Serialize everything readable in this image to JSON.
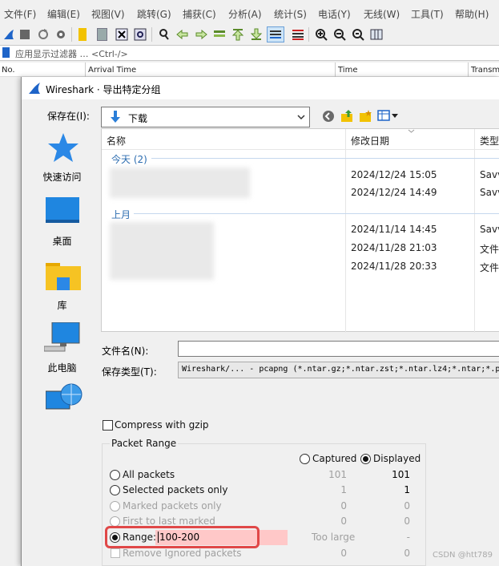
{
  "menu": [
    "文件(F)",
    "编辑(E)",
    "视图(V)",
    "跳转(G)",
    "捕获(C)",
    "分析(A)",
    "统计(S)",
    "电话(Y)",
    "无线(W)",
    "工具(T)",
    "帮助(H)"
  ],
  "filter_bar": {
    "placeholder": "应用显示过滤器 … <Ctrl-/>"
  },
  "packet_columns": [
    "No.",
    "Arrival Time",
    "Time",
    "Transm"
  ],
  "dialog": {
    "title": "Wireshark · 导出特定分组",
    "save_in_label": "保存在(I):",
    "save_in_value": "下载",
    "places": [
      "快速访问",
      "桌面",
      "库",
      "此电脑"
    ],
    "list_headers": [
      "名称",
      "修改日期",
      "类型"
    ],
    "groups": [
      {
        "label": "今天 (2)",
        "rows": [
          {
            "date": "2024/12/24 15:05",
            "type": "Savv"
          },
          {
            "date": "2024/12/24 14:49",
            "type": "Savv"
          }
        ]
      },
      {
        "label": "上月",
        "rows": [
          {
            "date": "2024/11/14 14:45",
            "type": "Savv"
          },
          {
            "date": "2024/11/28 21:03",
            "type": "文件"
          },
          {
            "date": "2024/11/28 20:33",
            "type": "文件"
          }
        ]
      }
    ],
    "filename_label": "文件名(N):",
    "filename_value": "",
    "filetype_label": "保存类型(T):",
    "filetype_value": "Wireshark/... - pcapng (*.ntar.gz;*.ntar.zst;*.ntar.lz4;*.ntar;*.pc",
    "compress_label": "Compress with gzip",
    "packet_range": {
      "title": "Packet Range",
      "captured_label": "Captured",
      "displayed_label": "Displayed",
      "rows": [
        {
          "label": "All packets",
          "captured": "101",
          "displayed": "101"
        },
        {
          "label": "Selected packets only",
          "captured": "1",
          "displayed": "1"
        },
        {
          "label": "Marked packets only",
          "captured": "0",
          "displayed": "0"
        },
        {
          "label": "First to last marked",
          "captured": "0",
          "displayed": "0"
        },
        {
          "label": "Range:",
          "captured": "Too large",
          "displayed": "-"
        },
        {
          "label": "Remove Ignored packets",
          "captured": "0",
          "displayed": "0"
        }
      ],
      "range_value": "100-200"
    }
  },
  "watermark": "CSDN @htt789"
}
